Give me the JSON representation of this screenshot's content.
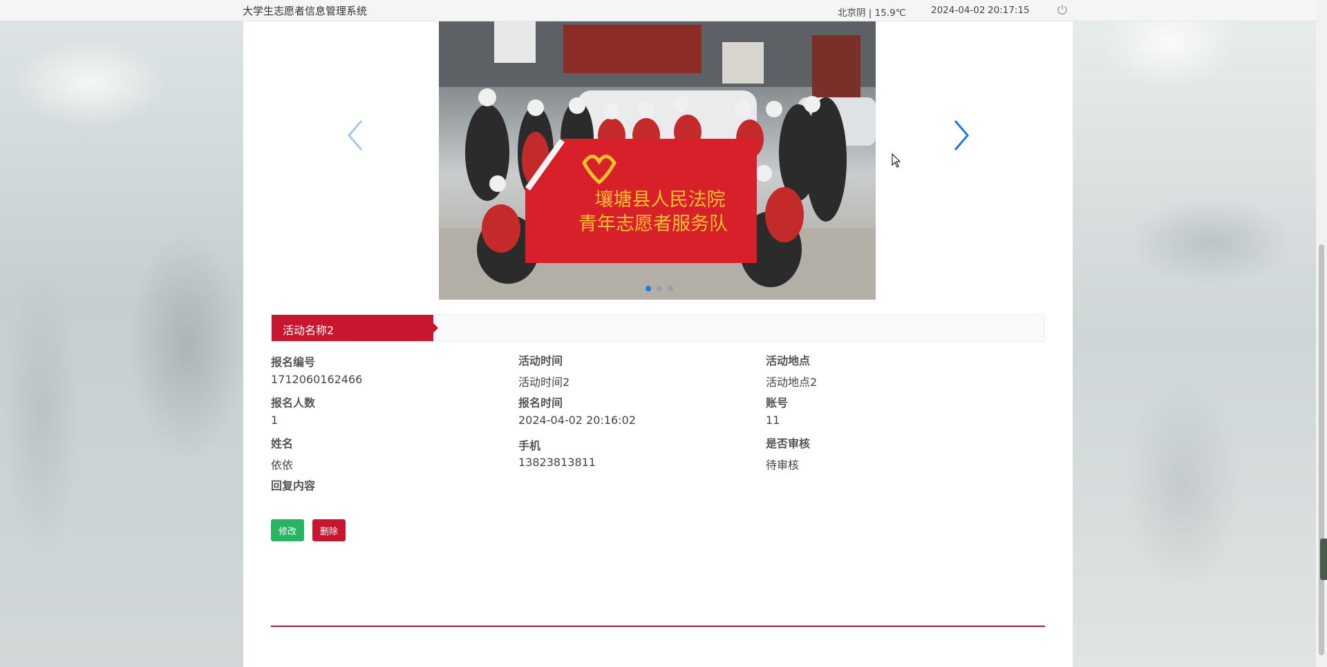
{
  "topbar": {
    "title": "大学生志愿者信息管理系统",
    "weather": "北京阴 | 15.9℃",
    "date": "2024-04-02",
    "time": "20:17:15"
  },
  "carousel": {
    "banner_line1": "壤塘县人民法院",
    "banner_line2": "青年志愿者服务队",
    "slide_count": 3,
    "active_slide": 1
  },
  "activity": {
    "title": "活动名称2"
  },
  "details": {
    "reg_no_label": "报名编号",
    "reg_no": "1712060162466",
    "activity_time_label": "活动时间",
    "activity_time": "活动时间2",
    "location_label": "活动地点",
    "location": "活动地点2",
    "count_label": "报名人数",
    "count": "1",
    "reg_time_label": "报名时间",
    "reg_time": "2024-04-02 20:16:02",
    "account_label": "账号",
    "account": "11",
    "name_label": "姓名",
    "name": "依依",
    "phone_label": "手机",
    "phone": "13823813811",
    "audit_label": "是否审核",
    "audit": "待审核",
    "reply_label": "回复内容",
    "reply": ""
  },
  "actions": {
    "edit_label": "修改",
    "delete_label": "删除"
  },
  "colors": {
    "accent_red": "#c8162e",
    "edit_green": "#28b463",
    "carousel_blue": "#1e78e6"
  }
}
